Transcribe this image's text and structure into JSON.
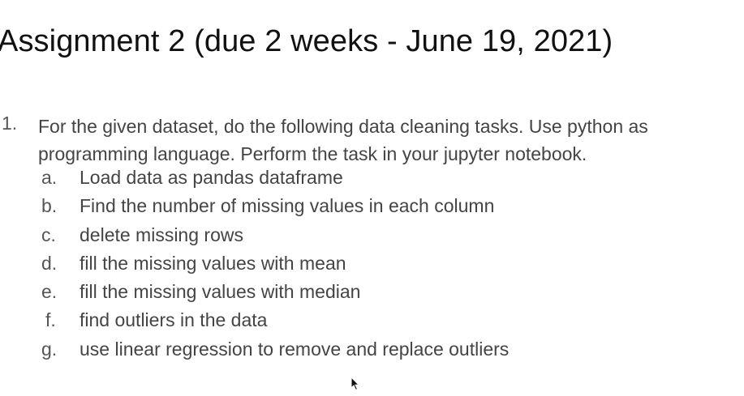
{
  "title": "Assignment 2 (due 2 weeks - June 19, 2021)",
  "question": {
    "number": "1.",
    "text": "For the given dataset, do the following data cleaning tasks. Use python as programming language. Perform the task in your jupyter notebook."
  },
  "subitems": [
    {
      "letter": "a.",
      "text": "Load data as pandas dataframe"
    },
    {
      "letter": "b.",
      "text": "Find the number of missing values in each column"
    },
    {
      "letter": "c.",
      "text": "delete missing rows"
    },
    {
      "letter": "d.",
      "text": "fill the missing values with mean"
    },
    {
      "letter": "e.",
      "text": "fill the missing values with median"
    },
    {
      "letter": "f.",
      "text": "find outliers in the data"
    },
    {
      "letter": "g.",
      "text": "use linear regression to remove and replace outliers"
    }
  ],
  "icons": {
    "cursor": "mouse-pointer-icon"
  }
}
